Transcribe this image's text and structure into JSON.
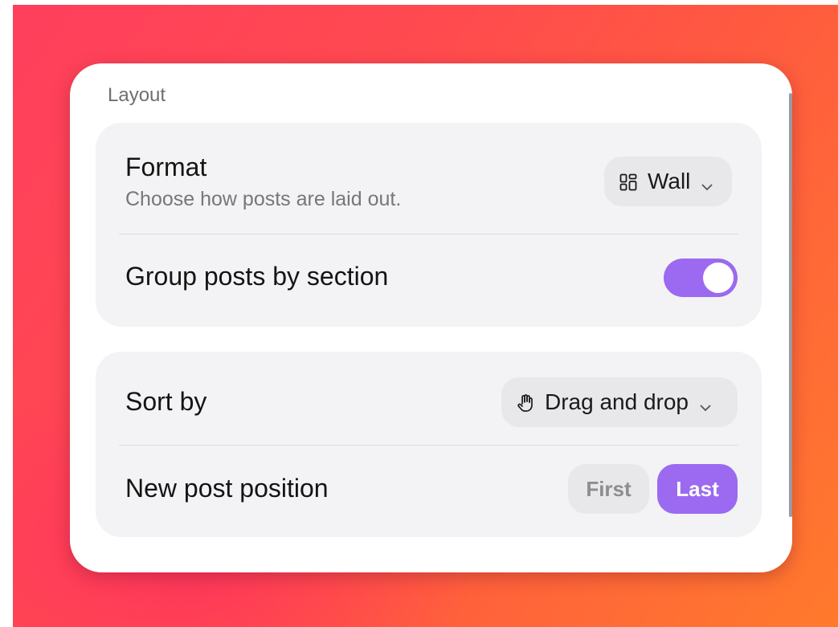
{
  "panel": {
    "title": "Layout"
  },
  "format": {
    "label": "Format",
    "description": "Choose how posts are laid out.",
    "value": "Wall",
    "icon": "grid-layout-icon"
  },
  "group_posts": {
    "label": "Group posts by section",
    "enabled": true
  },
  "sort": {
    "label": "Sort by",
    "value": "Drag and drop",
    "icon": "hand-pointer-icon"
  },
  "new_post_position": {
    "label": "New post position",
    "options": [
      "First",
      "Last"
    ],
    "selected": "Last"
  },
  "colors": {
    "accent": "#9b6af0",
    "card": "#f3f3f5"
  }
}
